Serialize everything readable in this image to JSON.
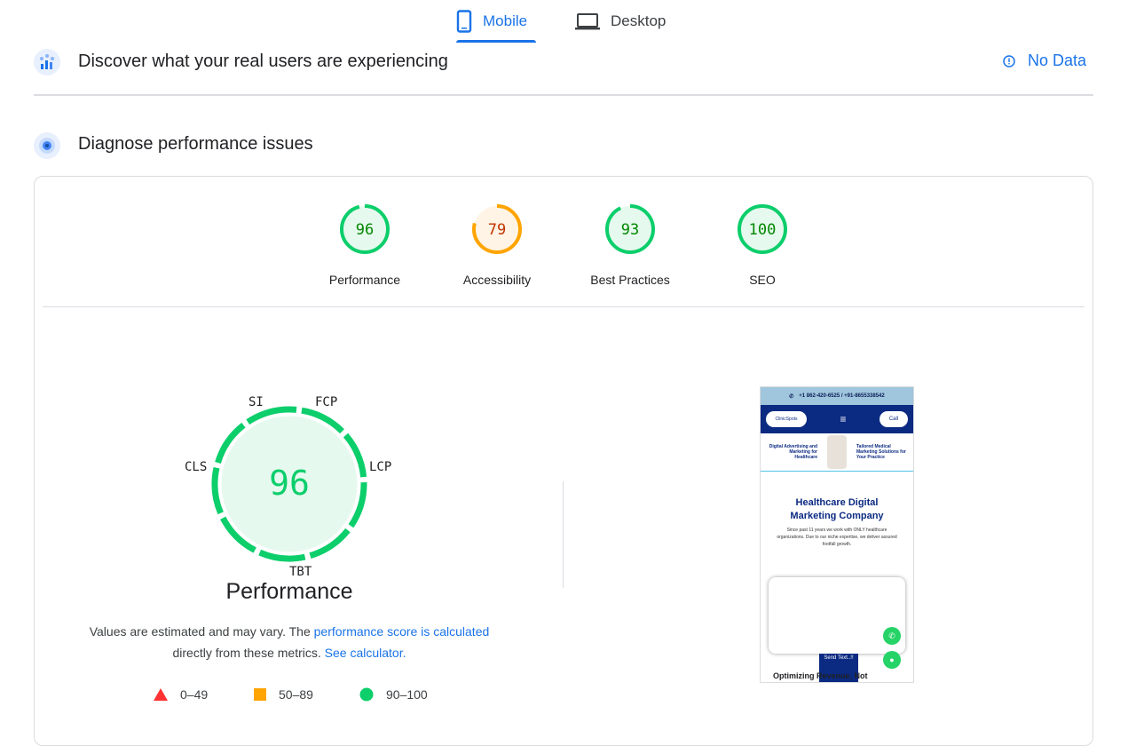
{
  "tabs": [
    {
      "label": "Mobile",
      "icon": "phone-icon"
    },
    {
      "label": "Desktop",
      "icon": "laptop-icon"
    }
  ],
  "field_data": {
    "title": "Discover what your real users are experiencing",
    "status": "No Data"
  },
  "diagnose": {
    "title": "Diagnose performance issues"
  },
  "categories": [
    {
      "label": "Performance",
      "score": "96",
      "color": "#0cce6b",
      "text_color": "#008800",
      "bg": "#e6f9ee"
    },
    {
      "label": "Accessibility",
      "score": "79",
      "color": "#ffa400",
      "text_color": "#c33300",
      "bg": "#fff4e5"
    },
    {
      "label": "Best Practices",
      "score": "93",
      "color": "#0cce6b",
      "text_color": "#008800",
      "bg": "#e6f9ee"
    },
    {
      "label": "SEO",
      "score": "100",
      "color": "#0cce6b",
      "text_color": "#008800",
      "bg": "#e6f9ee"
    }
  ],
  "performance": {
    "score": "96",
    "title": "Performance",
    "metric_labels": {
      "si": "SI",
      "fcp": "FCP",
      "lcp": "LCP",
      "tbt": "TBT",
      "cls": "CLS"
    },
    "note_prefix": "Values are estimated and may vary. The",
    "note_link": "performance score is calculated",
    "note_middle": "directly from these metrics.",
    "note_link2": "See calculator.",
    "legend": [
      {
        "range": "0–49",
        "color": "#ff3333"
      },
      {
        "range": "50–89",
        "color": "#ffa400"
      },
      {
        "range": "90–100",
        "color": "#0cce6b"
      }
    ]
  },
  "screenshot": {
    "phone": "+1 862-420-6525 / +91-8655338542",
    "logo": "ClinicSpots",
    "call": "Call",
    "hero_left": "Digital Advertising and Marketing for Healthcare",
    "hero_right": "Tailored Medical Marketing Solutions for Your Practice",
    "h1_line1": "Healthcare Digital",
    "h1_line2": "Marketing Company",
    "p": "Since past 11 years we work with ONLY healthcare organizations. Due to our niche expertise, we deliver assured footfall growth.",
    "send": "Send Text..!!",
    "bottom": "Optimizing Revenue, Not"
  }
}
